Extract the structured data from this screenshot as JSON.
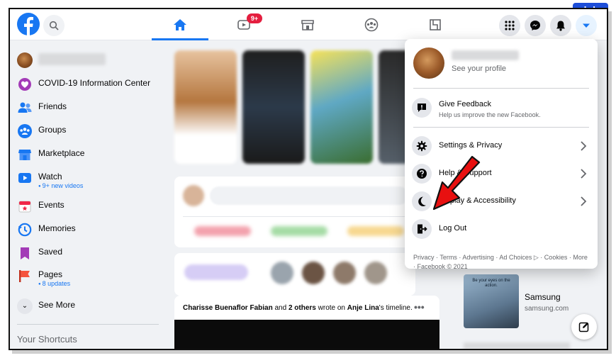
{
  "watermark": "alphr",
  "topbar": {
    "notification_badge": "9+",
    "brand_color": "#1877f2"
  },
  "sidebar": {
    "profile_name": "",
    "items": [
      {
        "label": "COVID-19 Information Center",
        "icon": "covid-info-icon"
      },
      {
        "label": "Friends",
        "icon": "friends-icon"
      },
      {
        "label": "Groups",
        "icon": "groups-icon"
      },
      {
        "label": "Marketplace",
        "icon": "marketplace-icon"
      },
      {
        "label": "Watch",
        "sub": "9+ new videos",
        "icon": "watch-icon"
      },
      {
        "label": "Events",
        "icon": "events-icon"
      },
      {
        "label": "Memories",
        "icon": "memories-icon"
      },
      {
        "label": "Saved",
        "icon": "saved-icon"
      },
      {
        "label": "Pages",
        "sub": "8 updates",
        "icon": "pages-icon"
      },
      {
        "label": "See More",
        "icon": "chevron-down-icon"
      }
    ],
    "shortcuts_heading": "Your Shortcuts"
  },
  "post": {
    "author": "Charisse Buenaflor Fabian",
    "and": "and",
    "others": "2 others",
    "wrote_on": "wrote on",
    "target": "Anje Lina",
    "suffix": "'s timeline.",
    "more": "•••"
  },
  "sponsored": {
    "image_tagline": "Be your eyes on the action.",
    "title": "Samsung",
    "url": "samsung.com"
  },
  "menu": {
    "profile_name": "",
    "see_profile": "See your profile",
    "feedback": {
      "label": "Give Feedback",
      "sub": "Help us improve the new Facebook."
    },
    "settings": "Settings & Privacy",
    "help": "Help & Support",
    "display": "Display & Accessibility",
    "logout": "Log Out",
    "footer": "Privacy · Terms · Advertising · Ad Choices ▷ · Cookies · More · Facebook © 2021"
  }
}
